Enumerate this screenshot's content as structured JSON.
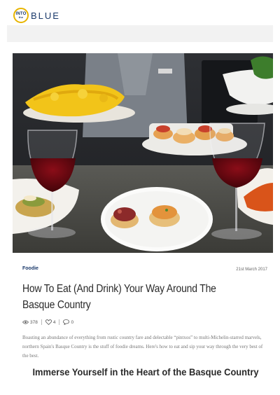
{
  "header": {
    "logo_into": "INTO",
    "logo_the": "the",
    "logo_blue": "BLUE"
  },
  "colors": {
    "brand_navy": "#1b3a6b",
    "brand_gold": "#e8b500"
  },
  "article": {
    "category": "Foodie",
    "date": "21st March 2017",
    "title": "How To Eat (And Drink) Your Way Around The Basque Country",
    "views": "378",
    "likes": "4",
    "comments": "0",
    "excerpt": "Boasting an abundance of everything from rustic country fare and delectable “pintxos” to multi-Michelin-starred marvels, northern Spain's Basque Country is the stuff of foodie dreams. Here's how to eat and sip your way through the very best of the best.",
    "subheading": "Immerse Yourself in the Heart of the Basque Country",
    "hero_image": "pintxos-and-red-wine-photo",
    "icons": {
      "views": "eye-icon",
      "likes": "heart-icon",
      "comments": "comment-icon"
    }
  }
}
